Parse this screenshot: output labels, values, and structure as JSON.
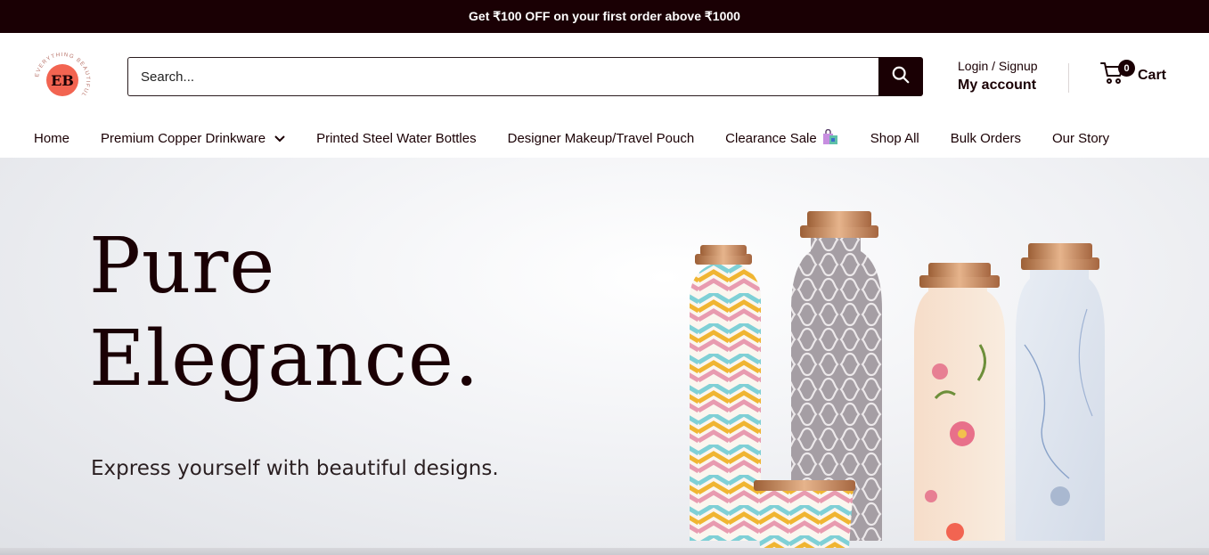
{
  "announcement": "Get ₹100 OFF on your first order above ₹1000",
  "logo": {
    "ring_text": "EVERYTHING BEAUTIFUL",
    "mark": "EB"
  },
  "search": {
    "placeholder": "Search..."
  },
  "account": {
    "login_label": "Login / Signup",
    "account_label": "My account"
  },
  "cart": {
    "count": "0",
    "label": "Cart"
  },
  "nav": {
    "home": "Home",
    "copper": "Premium Copper Drinkware",
    "steel": "Printed Steel Water Bottles",
    "pouch": "Designer Makeup/Travel Pouch",
    "clearance": "Clearance Sale",
    "shop_all": "Shop All",
    "bulk": "Bulk Orders",
    "story": "Our Story"
  },
  "hero": {
    "title_line1": "Pure",
    "title_line2": "Elegance.",
    "subtitle": "Express yourself with beautiful designs."
  },
  "colors": {
    "brand_dark": "#1a0004",
    "accent_coral": "#f26451",
    "copper": "#c98a5a"
  },
  "icons": [
    "search-icon",
    "cart-icon",
    "chevron-down-icon",
    "shopping-bag-icon"
  ]
}
